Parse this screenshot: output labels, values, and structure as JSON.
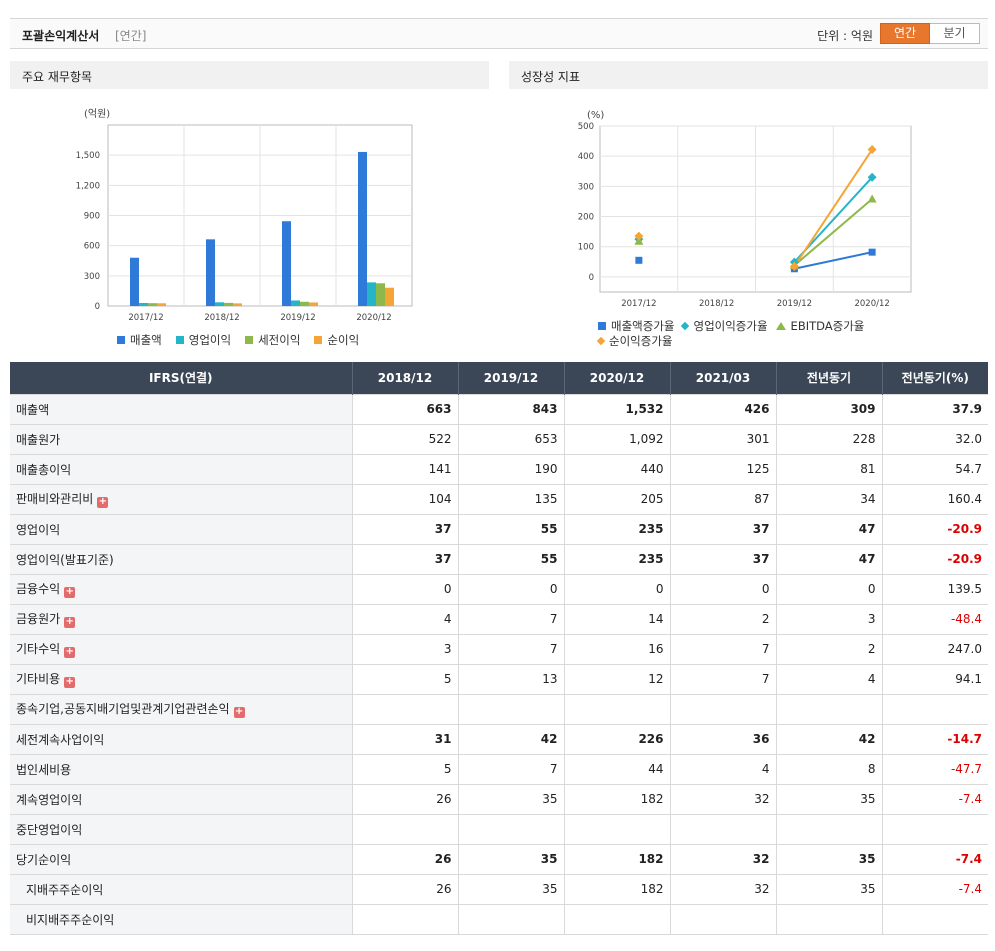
{
  "header": {
    "title": "포괄손익계산서",
    "subtitle": "[연간]",
    "unit_label": "단위 : 억원",
    "toggle": [
      "연간",
      "분기"
    ]
  },
  "panels": {
    "left_title": "주요 재무항목",
    "right_title": "성장성 지표"
  },
  "colors": {
    "sales": "#2f7ad9",
    "op_income": "#25b5c8",
    "pretax": "#8db84a",
    "net": "#f4a535",
    "accent": "#e8772e",
    "header_bg": "#3b4756"
  },
  "chart_data": [
    {
      "type": "bar",
      "unit_label": "(억원)",
      "categories": [
        "2017/12",
        "2018/12",
        "2019/12",
        "2020/12"
      ],
      "ylim": [
        0,
        1800
      ],
      "yticks": [
        0,
        300,
        600,
        900,
        1200,
        1500
      ],
      "ytick_labels": [
        "0",
        "300",
        "600",
        "900",
        "1,200",
        "1,500"
      ],
      "grid": true,
      "legend_position": "bottom",
      "series": [
        {
          "name": "매출액",
          "color": "#2f7ad9",
          "values": [
            480,
            663,
            843,
            1532
          ]
        },
        {
          "name": "영업이익",
          "color": "#25b5c8",
          "values": [
            30,
            37,
            55,
            235
          ]
        },
        {
          "name": "세전이익",
          "color": "#8db84a",
          "values": [
            28,
            31,
            42,
            226
          ]
        },
        {
          "name": "순이익",
          "color": "#f4a535",
          "values": [
            27,
            26,
            35,
            182
          ]
        }
      ]
    },
    {
      "type": "line",
      "unit_label": "(%)",
      "categories": [
        "2017/12",
        "2018/12",
        "2019/12",
        "2020/12"
      ],
      "ylim": [
        -50,
        500
      ],
      "yticks": [
        0,
        100,
        200,
        300,
        400,
        500
      ],
      "grid": true,
      "legend_position": "bottom",
      "series": [
        {
          "name": "매출액증가율",
          "color": "#2f7ad9",
          "marker": "square",
          "values": [
            55,
            null,
            27,
            82
          ]
        },
        {
          "name": "영업이익증가율",
          "color": "#25b5c8",
          "marker": "diamond",
          "values": [
            125,
            null,
            49,
            330
          ]
        },
        {
          "name": "EBITDA증가율",
          "color": "#8db84a",
          "marker": "triangle",
          "values": [
            118,
            null,
            38,
            258
          ]
        },
        {
          "name": "순이익증가율",
          "color": "#f4a535",
          "marker": "diamond",
          "values": [
            135,
            null,
            35,
            422
          ]
        }
      ]
    }
  ],
  "table": {
    "columns": [
      "IFRS(연결)",
      "2018/12",
      "2019/12",
      "2020/12",
      "2021/03",
      "전년동기",
      "전년동기(%)"
    ],
    "rows": [
      {
        "label": "매출액",
        "bold": true,
        "plus": false,
        "indent": false,
        "values": [
          "663",
          "843",
          "1,532",
          "426",
          "309",
          "37.9"
        ],
        "neg": false
      },
      {
        "label": "매출원가",
        "bold": false,
        "plus": false,
        "indent": false,
        "values": [
          "522",
          "653",
          "1,092",
          "301",
          "228",
          "32.0"
        ],
        "neg": false
      },
      {
        "label": "매출총이익",
        "bold": false,
        "plus": false,
        "indent": false,
        "values": [
          "141",
          "190",
          "440",
          "125",
          "81",
          "54.7"
        ],
        "neg": false
      },
      {
        "label": "판매비와관리비",
        "bold": false,
        "plus": true,
        "indent": false,
        "values": [
          "104",
          "135",
          "205",
          "87",
          "34",
          "160.4"
        ],
        "neg": false
      },
      {
        "label": "영업이익",
        "bold": true,
        "plus": false,
        "indent": false,
        "values": [
          "37",
          "55",
          "235",
          "37",
          "47",
          "-20.9"
        ],
        "neg": true
      },
      {
        "label": "영업이익(발표기준)",
        "bold": true,
        "plus": false,
        "indent": false,
        "values": [
          "37",
          "55",
          "235",
          "37",
          "47",
          "-20.9"
        ],
        "neg": true
      },
      {
        "label": "금융수익",
        "bold": false,
        "plus": true,
        "indent": false,
        "values": [
          "0",
          "0",
          "0",
          "0",
          "0",
          "139.5"
        ],
        "neg": false
      },
      {
        "label": "금융원가",
        "bold": false,
        "plus": true,
        "indent": false,
        "values": [
          "4",
          "7",
          "14",
          "2",
          "3",
          "-48.4"
        ],
        "neg": true
      },
      {
        "label": "기타수익",
        "bold": false,
        "plus": true,
        "indent": false,
        "values": [
          "3",
          "7",
          "16",
          "7",
          "2",
          "247.0"
        ],
        "neg": false
      },
      {
        "label": "기타비용",
        "bold": false,
        "plus": true,
        "indent": false,
        "values": [
          "5",
          "13",
          "12",
          "7",
          "4",
          "94.1"
        ],
        "neg": false
      },
      {
        "label": "종속기업,공동지배기업및관계기업관련손익",
        "bold": false,
        "plus": true,
        "indent": false,
        "values": [
          "",
          "",
          "",
          "",
          "",
          ""
        ],
        "neg": false
      },
      {
        "label": "세전계속사업이익",
        "bold": true,
        "plus": false,
        "indent": false,
        "values": [
          "31",
          "42",
          "226",
          "36",
          "42",
          "-14.7"
        ],
        "neg": true
      },
      {
        "label": "법인세비용",
        "bold": false,
        "plus": false,
        "indent": false,
        "values": [
          "5",
          "7",
          "44",
          "4",
          "8",
          "-47.7"
        ],
        "neg": true
      },
      {
        "label": "계속영업이익",
        "bold": false,
        "plus": false,
        "indent": false,
        "values": [
          "26",
          "35",
          "182",
          "32",
          "35",
          "-7.4"
        ],
        "neg": true
      },
      {
        "label": "중단영업이익",
        "bold": false,
        "plus": false,
        "indent": false,
        "values": [
          "",
          "",
          "",
          "",
          "",
          ""
        ],
        "neg": false
      },
      {
        "label": "당기순이익",
        "bold": true,
        "plus": false,
        "indent": false,
        "values": [
          "26",
          "35",
          "182",
          "32",
          "35",
          "-7.4"
        ],
        "neg": true
      },
      {
        "label": "지배주주순이익",
        "bold": false,
        "plus": false,
        "indent": true,
        "values": [
          "26",
          "35",
          "182",
          "32",
          "35",
          "-7.4"
        ],
        "neg": true
      },
      {
        "label": "비지배주주순이익",
        "bold": false,
        "plus": false,
        "indent": true,
        "values": [
          "",
          "",
          "",
          "",
          "",
          ""
        ],
        "neg": false
      }
    ]
  }
}
